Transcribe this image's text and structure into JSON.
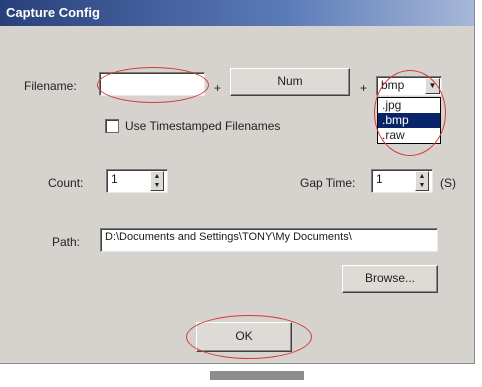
{
  "window": {
    "title": "Capture Config"
  },
  "filename": {
    "label": "Filename:",
    "value": "",
    "plus1": "+",
    "num_button": "Num",
    "plus2": "+",
    "ext_selected": "bmp",
    "ext_options": [
      ".jpg",
      ".bmp",
      ".raw"
    ]
  },
  "timestamp": {
    "label": "Use Timestamped Filenames",
    "checked": false
  },
  "count": {
    "label": "Count:",
    "value": "1"
  },
  "gap": {
    "label": "Gap Time:",
    "value": "1",
    "unit": "(S)"
  },
  "path": {
    "label": "Path:",
    "value": "D:\\Documents and Settings\\TONY\\My Documents\\"
  },
  "browse_button": "Browse...",
  "ok_button": "OK"
}
